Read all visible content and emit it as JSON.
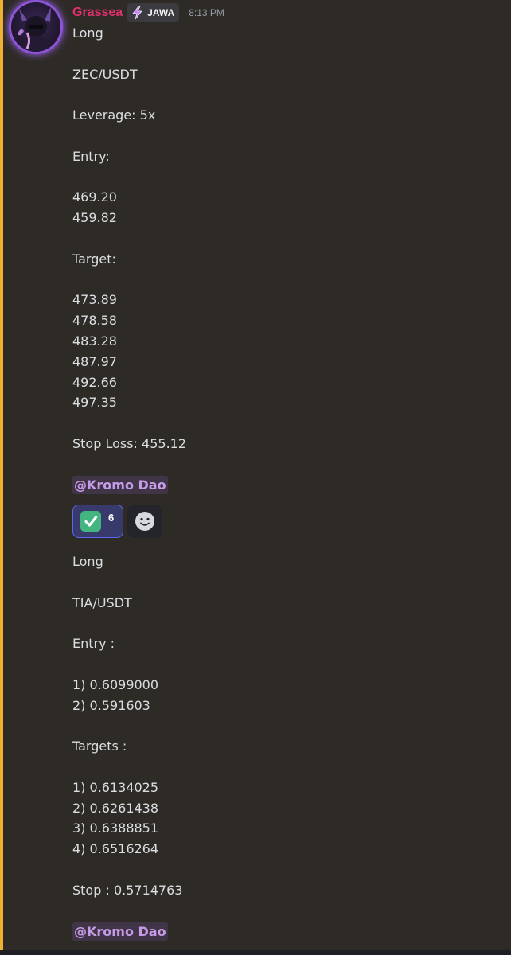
{
  "message": {
    "username": "Grassea",
    "tag": "JAWA",
    "timestamp": "8:13 PM",
    "colors": {
      "username": "#e0306e",
      "accent_bar": "#f0b132",
      "mention": "#c89be8",
      "reaction_border": "#5865f2"
    }
  },
  "posts": [
    {
      "lines": [
        "Long",
        "",
        "ZEC/USDT",
        "",
        "Leverage: 5x",
        "",
        "Entry:",
        "",
        "469.20",
        "459.82",
        "",
        "Target:",
        "",
        "473.89",
        "478.58",
        "483.28",
        "487.97",
        "492.66",
        "497.35",
        "",
        "Stop Loss: 455.12"
      ],
      "mention": "@Kromo Dao",
      "reaction": {
        "emoji_icon": "white-check-mark-icon",
        "count": "6"
      },
      "add_reaction_icon": "add-reaction-smiley-icon"
    },
    {
      "lines": [
        "Long",
        "",
        "TIA/USDT",
        "",
        "Entry :",
        "",
        "1) 0.6099000",
        "2) 0.591603",
        "",
        "Targets :",
        "",
        "1) 0.6134025",
        "2) 0.6261438",
        "3) 0.6388851",
        "4) 0.6516264",
        "",
        "Stop : 0.5714763"
      ],
      "mention": "@Kromo Dao"
    }
  ]
}
